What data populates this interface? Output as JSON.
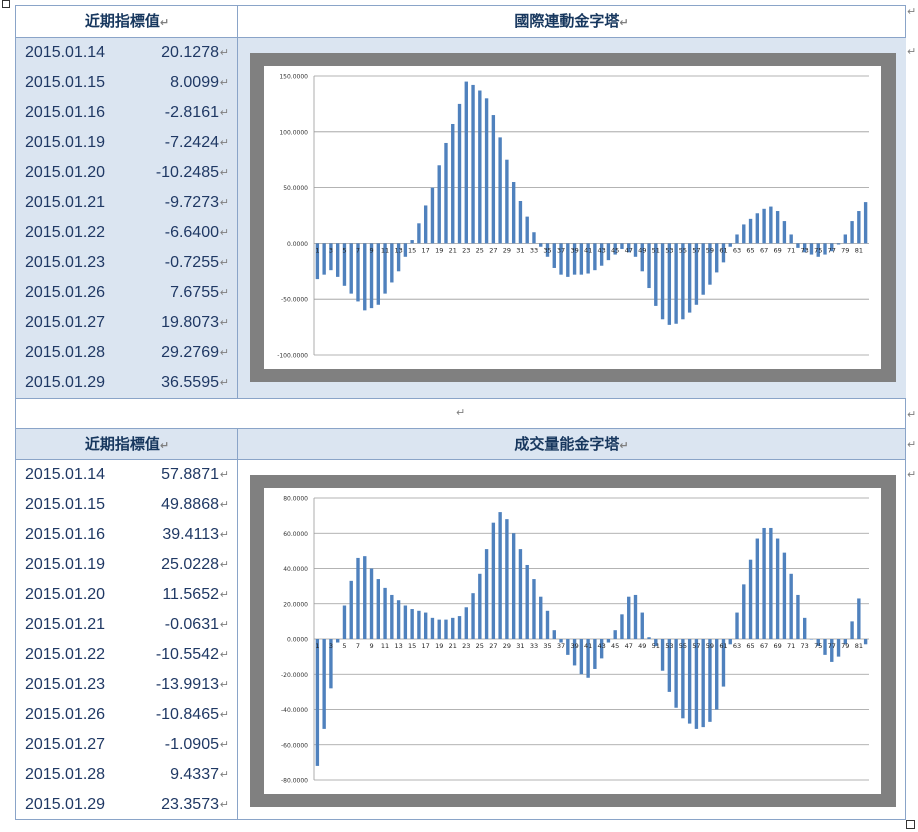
{
  "section1": {
    "left_header": "近期指標值",
    "right_header": "國際連動金字塔",
    "rows": [
      {
        "date": "2015.01.14",
        "value": "20.1278"
      },
      {
        "date": "2015.01.15",
        "value": "8.0099"
      },
      {
        "date": "2015.01.16",
        "value": "-2.8161"
      },
      {
        "date": "2015.01.19",
        "value": "-7.2424"
      },
      {
        "date": "2015.01.20",
        "value": "-10.2485"
      },
      {
        "date": "2015.01.21",
        "value": "-9.7273"
      },
      {
        "date": "2015.01.22",
        "value": "-6.6400"
      },
      {
        "date": "2015.01.23",
        "value": "-0.7255"
      },
      {
        "date": "2015.01.26",
        "value": "7.6755"
      },
      {
        "date": "2015.01.27",
        "value": "19.8073"
      },
      {
        "date": "2015.01.28",
        "value": "29.2769"
      },
      {
        "date": "2015.01.29",
        "value": "36.5595"
      }
    ]
  },
  "section2": {
    "left_header": "近期指標值",
    "right_header": "成交量能金字塔",
    "rows": [
      {
        "date": "2015.01.14",
        "value": "57.8871"
      },
      {
        "date": "2015.01.15",
        "value": "49.8868"
      },
      {
        "date": "2015.01.16",
        "value": "39.4113"
      },
      {
        "date": "2015.01.19",
        "value": "25.0228"
      },
      {
        "date": "2015.01.20",
        "value": "11.5652"
      },
      {
        "date": "2015.01.21",
        "value": "-0.0631"
      },
      {
        "date": "2015.01.22",
        "value": "-10.5542"
      },
      {
        "date": "2015.01.23",
        "value": "-13.9913"
      },
      {
        "date": "2015.01.26",
        "value": "-10.8465"
      },
      {
        "date": "2015.01.27",
        "value": "-1.0905"
      },
      {
        "date": "2015.01.28",
        "value": "9.4337"
      },
      {
        "date": "2015.01.29",
        "value": "23.3573"
      }
    ]
  },
  "paragraph_mark": "↵",
  "chart_data": [
    {
      "type": "bar",
      "title": "",
      "xlabel": "",
      "ylabel": "",
      "ylim": [
        -100,
        150
      ],
      "yticks": [
        "150.0000",
        "100.0000",
        "50.0000",
        "0.0000",
        "-50.0000",
        "-100.0000"
      ],
      "ytick_values": [
        150,
        100,
        50,
        0,
        -50,
        -100
      ],
      "xtick_labels": [
        "1",
        "3",
        "5",
        "7",
        "9",
        "11",
        "13",
        "15",
        "17",
        "19",
        "21",
        "23",
        "25",
        "27",
        "29",
        "31",
        "33",
        "35",
        "37",
        "39",
        "41",
        "43",
        "45",
        "47",
        "49",
        "51",
        "53",
        "55",
        "57",
        "59",
        "61",
        "63",
        "65",
        "67",
        "69",
        "71",
        "73",
        "75",
        "77",
        "79",
        "81"
      ],
      "grid": true,
      "bar_color": "#4f81bd",
      "x": [
        1,
        2,
        3,
        4,
        5,
        6,
        7,
        8,
        9,
        10,
        11,
        12,
        13,
        14,
        15,
        16,
        17,
        18,
        19,
        20,
        21,
        22,
        23,
        24,
        25,
        26,
        27,
        28,
        29,
        30,
        31,
        32,
        33,
        34,
        35,
        36,
        37,
        38,
        39,
        40,
        41,
        42,
        43,
        44,
        45,
        46,
        47,
        48,
        49,
        50,
        51,
        52,
        53,
        54,
        55,
        56,
        57,
        58,
        59,
        60,
        61,
        62,
        63,
        64,
        65,
        66,
        67,
        68,
        69,
        70,
        71,
        72,
        73,
        74,
        75,
        76,
        77,
        78,
        79,
        80,
        81,
        82
      ],
      "values": [
        -32,
        -28,
        -24,
        -30,
        -38,
        -45,
        -52,
        -60,
        -58,
        -55,
        -45,
        -35,
        -25,
        -12,
        3,
        18,
        34,
        50,
        70,
        90,
        107,
        125,
        145,
        142,
        137,
        130,
        115,
        95,
        75,
        55,
        38,
        24,
        10,
        -3,
        -12,
        -22,
        -28,
        -30,
        -28,
        -28,
        -27,
        -24,
        -20,
        -15,
        -10,
        -5,
        -8,
        -12,
        -25,
        -40,
        -56,
        -68,
        -73,
        -72,
        -68,
        -62,
        -55,
        -46,
        -37,
        -26,
        -17,
        -3,
        8,
        17,
        22,
        27,
        31,
        33,
        29,
        20,
        8,
        -4,
        -8,
        -10,
        -12,
        -10,
        -7,
        -1,
        8,
        20,
        29,
        37
      ]
    },
    {
      "type": "bar",
      "title": "",
      "xlabel": "",
      "ylabel": "",
      "ylim": [
        -80,
        80
      ],
      "yticks": [
        "80.0000",
        "60.0000",
        "40.0000",
        "20.0000",
        "0.0000",
        "-20.0000",
        "-40.0000",
        "-60.0000",
        "-80.0000"
      ],
      "ytick_values": [
        80,
        60,
        40,
        20,
        0,
        -20,
        -40,
        -60,
        -80
      ],
      "xtick_labels": [
        "1",
        "3",
        "5",
        "7",
        "9",
        "11",
        "13",
        "15",
        "17",
        "19",
        "21",
        "23",
        "25",
        "27",
        "29",
        "31",
        "33",
        "35",
        "37",
        "39",
        "41",
        "43",
        "45",
        "47",
        "49",
        "51",
        "53",
        "55",
        "57",
        "59",
        "61",
        "63",
        "65",
        "67",
        "69",
        "71",
        "73",
        "75",
        "77",
        "79",
        "81"
      ],
      "grid": true,
      "bar_color": "#4f81bd",
      "x": [
        1,
        2,
        3,
        4,
        5,
        6,
        7,
        8,
        9,
        10,
        11,
        12,
        13,
        14,
        15,
        16,
        17,
        18,
        19,
        20,
        21,
        22,
        23,
        24,
        25,
        26,
        27,
        28,
        29,
        30,
        31,
        32,
        33,
        34,
        35,
        36,
        37,
        38,
        39,
        40,
        41,
        42,
        43,
        44,
        45,
        46,
        47,
        48,
        49,
        50,
        51,
        52,
        53,
        54,
        55,
        56,
        57,
        58,
        59,
        60,
        61,
        62,
        63,
        64,
        65,
        66,
        67,
        68,
        69,
        70,
        71,
        72,
        73,
        74,
        75,
        76,
        77,
        78,
        79,
        80,
        81,
        82
      ],
      "values": [
        -72,
        -51,
        -28,
        -2,
        19,
        33,
        46,
        47,
        40,
        34,
        29,
        25,
        22,
        19,
        17,
        16,
        15,
        12,
        11,
        11,
        12,
        13,
        18,
        26,
        37,
        51,
        66,
        72,
        68,
        60,
        51,
        42,
        34,
        24,
        16,
        5,
        -2,
        -9,
        -15,
        -20,
        -22,
        -17,
        -11,
        -2,
        5,
        14,
        24,
        25,
        15,
        1,
        -4,
        -18,
        -30,
        -39,
        -45,
        -48,
        -51,
        -50,
        -47,
        -40,
        -27,
        -3,
        15,
        31,
        45,
        57,
        63,
        63,
        57,
        49,
        37,
        25,
        12,
        0,
        -4,
        -9,
        -13,
        -10,
        -3,
        10,
        23,
        -3
      ]
    }
  ]
}
